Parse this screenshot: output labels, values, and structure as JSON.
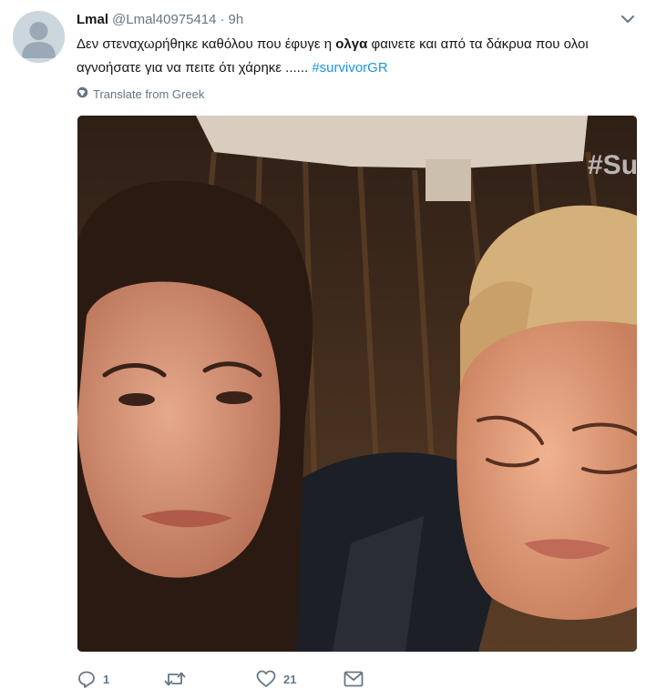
{
  "tweet": {
    "display_name": "Lmal",
    "handle": "@Lmal40975414",
    "separator": "·",
    "time": "9h",
    "text_part1": "Δεν στεναχωρήθηκε καθόλου που έφυγε η ",
    "text_bold": "ολγα",
    "text_part2": " φαινετε και από τα δάκρυα που ολοι αγνοήσατε για να πειτε ότι χάρηκε  ......  ",
    "hashtag": "#survivorGR",
    "translate_label": "Translate from Greek",
    "media_overlay_text": "#Su",
    "media_alt": "Two crying women"
  },
  "actions": {
    "reply_count": "1",
    "retweet_count": "",
    "like_count": "21"
  },
  "icons": {
    "avatar": "default-avatar-icon",
    "caret": "chevron-down-icon",
    "translate": "globe-icon",
    "reply": "reply-icon",
    "retweet": "retweet-icon",
    "like": "heart-icon",
    "dm": "envelope-icon"
  },
  "colors": {
    "text": "#14171a",
    "secondary": "#657786",
    "link": "#1b95e0",
    "avatar_bg": "#ccd6dd",
    "avatar_fg": "#9aa9b5"
  }
}
